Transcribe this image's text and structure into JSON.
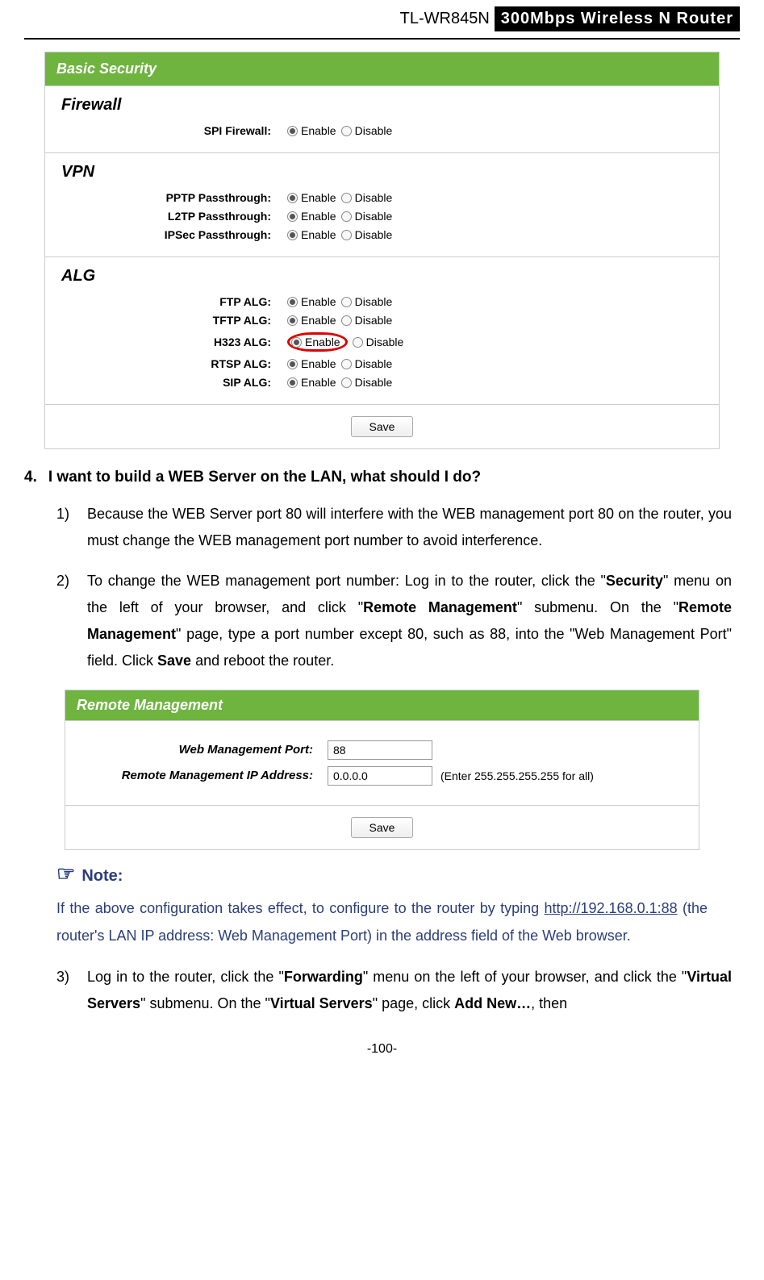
{
  "header": {
    "model": "TL-WR845N",
    "desc": "300Mbps  Wireless  N  Router"
  },
  "basicSecurity": {
    "title": "Basic Security",
    "firewall": {
      "title": "Firewall",
      "spi": {
        "label": "SPI Firewall:",
        "enable": "Enable",
        "disable": "Disable"
      }
    },
    "vpn": {
      "title": "VPN",
      "pptp": {
        "label": "PPTP Passthrough:",
        "enable": "Enable",
        "disable": "Disable"
      },
      "l2tp": {
        "label": "L2TP Passthrough:",
        "enable": "Enable",
        "disable": "Disable"
      },
      "ipsec": {
        "label": "IPSec Passthrough:",
        "enable": "Enable",
        "disable": "Disable"
      }
    },
    "alg": {
      "title": "ALG",
      "ftp": {
        "label": "FTP ALG:",
        "enable": "Enable",
        "disable": "Disable"
      },
      "tftp": {
        "label": "TFTP ALG:",
        "enable": "Enable",
        "disable": "Disable"
      },
      "h323": {
        "label": "H323 ALG:",
        "enable": "Enable",
        "disable": "Disable"
      },
      "rtsp": {
        "label": "RTSP ALG:",
        "enable": "Enable",
        "disable": "Disable"
      },
      "sip": {
        "label": "SIP ALG:",
        "enable": "Enable",
        "disable": "Disable"
      }
    },
    "save": "Save"
  },
  "qa": {
    "num": "4.",
    "question": "I want to build a WEB Server on the LAN, what should I do?",
    "step1num": "1)",
    "step1": "Because the WEB Server port 80 will interfere with the WEB management port 80 on the router, you must change the WEB management port number to avoid interference.",
    "step2num": "2)",
    "step2_a": "To change the WEB management port number: Log in to the router, click the \"",
    "step2_b": "Security",
    "step2_c": "\" menu on the left of your browser, and click \"",
    "step2_d": "Remote Management",
    "step2_e": "\" submenu. On the \"",
    "step2_f": "Remote Management",
    "step2_g": "\" page, type a port number except 80, such as 88, into the \"Web Management Port\" field. Click ",
    "step2_h": "Save",
    "step2_i": " and reboot the router.",
    "step3num": "3)",
    "step3_a": "Log in to the router, click the \"",
    "step3_b": "Forwarding",
    "step3_c": "\" menu on the left of your browser, and click the \"",
    "step3_d": "Virtual Servers",
    "step3_e": "\" submenu. On the \"",
    "step3_f": "Virtual Servers",
    "step3_g": "\" page, click ",
    "step3_h": "Add New…",
    "step3_i": ", then"
  },
  "remote": {
    "title": "Remote Management",
    "portLabel": "Web Management Port:",
    "portValue": "88",
    "ipLabel": "Remote Management IP Address:",
    "ipValue": "0.0.0.0",
    "ipHint": "(Enter 255.255.255.255 for all)",
    "save": "Save"
  },
  "note": {
    "label": "Note:",
    "text_a": "If the above configuration takes effect, to configure to the router by typing ",
    "link": "http://192.168.0.1:88",
    "text_b": " (the router's LAN IP address: Web Management Port) in the address field of the Web browser."
  },
  "footer": "-100-"
}
